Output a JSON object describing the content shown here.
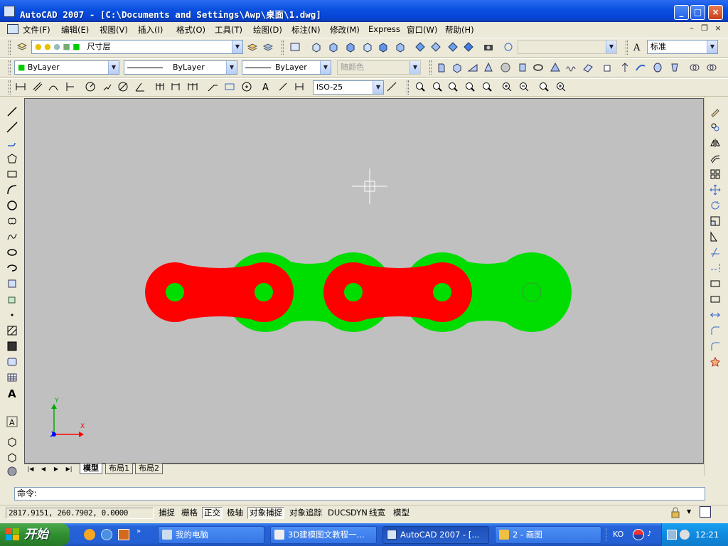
{
  "window": {
    "title": "AutoCAD 2007 - [C:\\Documents and Settings\\Awp\\桌面\\1.dwg]"
  },
  "menu": [
    "文件(F)",
    "编辑(E)",
    "视图(V)",
    "插入(I)",
    "格式(O)",
    "工具(T)",
    "绘图(D)",
    "标注(N)",
    "修改(M)",
    "Express",
    "窗口(W)",
    "帮助(H)"
  ],
  "toolbar": {
    "layer_current": "尺寸层",
    "text_style": "标准",
    "color_value": "ByLayer",
    "linetype_value": "ByLayer",
    "lineweight_value": "ByLayer",
    "plotstyle_value": "随颜色",
    "dim_style": "ISO-25"
  },
  "drawing": {
    "chain_colors": {
      "inner_link": "#ff0000",
      "outer_link": "#00dd00",
      "pin": "#00dd00",
      "background": "#c0c0c0"
    },
    "ucs_x": "X",
    "ucs_y": "Y"
  },
  "tabs": {
    "model": "模型",
    "layout1": "布局1",
    "layout2": "布局2"
  },
  "command": {
    "prompt": "命令:"
  },
  "status": {
    "coordinates": "2817.9151, 260.7902, 0.0000",
    "buttons": [
      "捕捉",
      "栅格",
      "正交",
      "极轴",
      "对象捕捉",
      "对象追踪",
      "DUCS",
      "DYN",
      "线宽",
      "模型"
    ]
  },
  "taskbar": {
    "start": "开始",
    "items": [
      "我的电脑",
      "3D建模图文教程一...",
      "AutoCAD 2007 - [...",
      "2 - 画图"
    ],
    "ime": "KO",
    "clock": "12:21"
  },
  "icons": [
    "layer-manager-icon",
    "lightbulb-icon",
    "sun-icon",
    "lock-icon",
    "color-square-icon",
    "zoom-icon",
    "pan-icon",
    "line-icon",
    "circle-icon",
    "arc-icon",
    "text-icon",
    "move-icon",
    "rotate-icon",
    "copy-icon",
    "mirror-icon",
    "erase-icon"
  ]
}
